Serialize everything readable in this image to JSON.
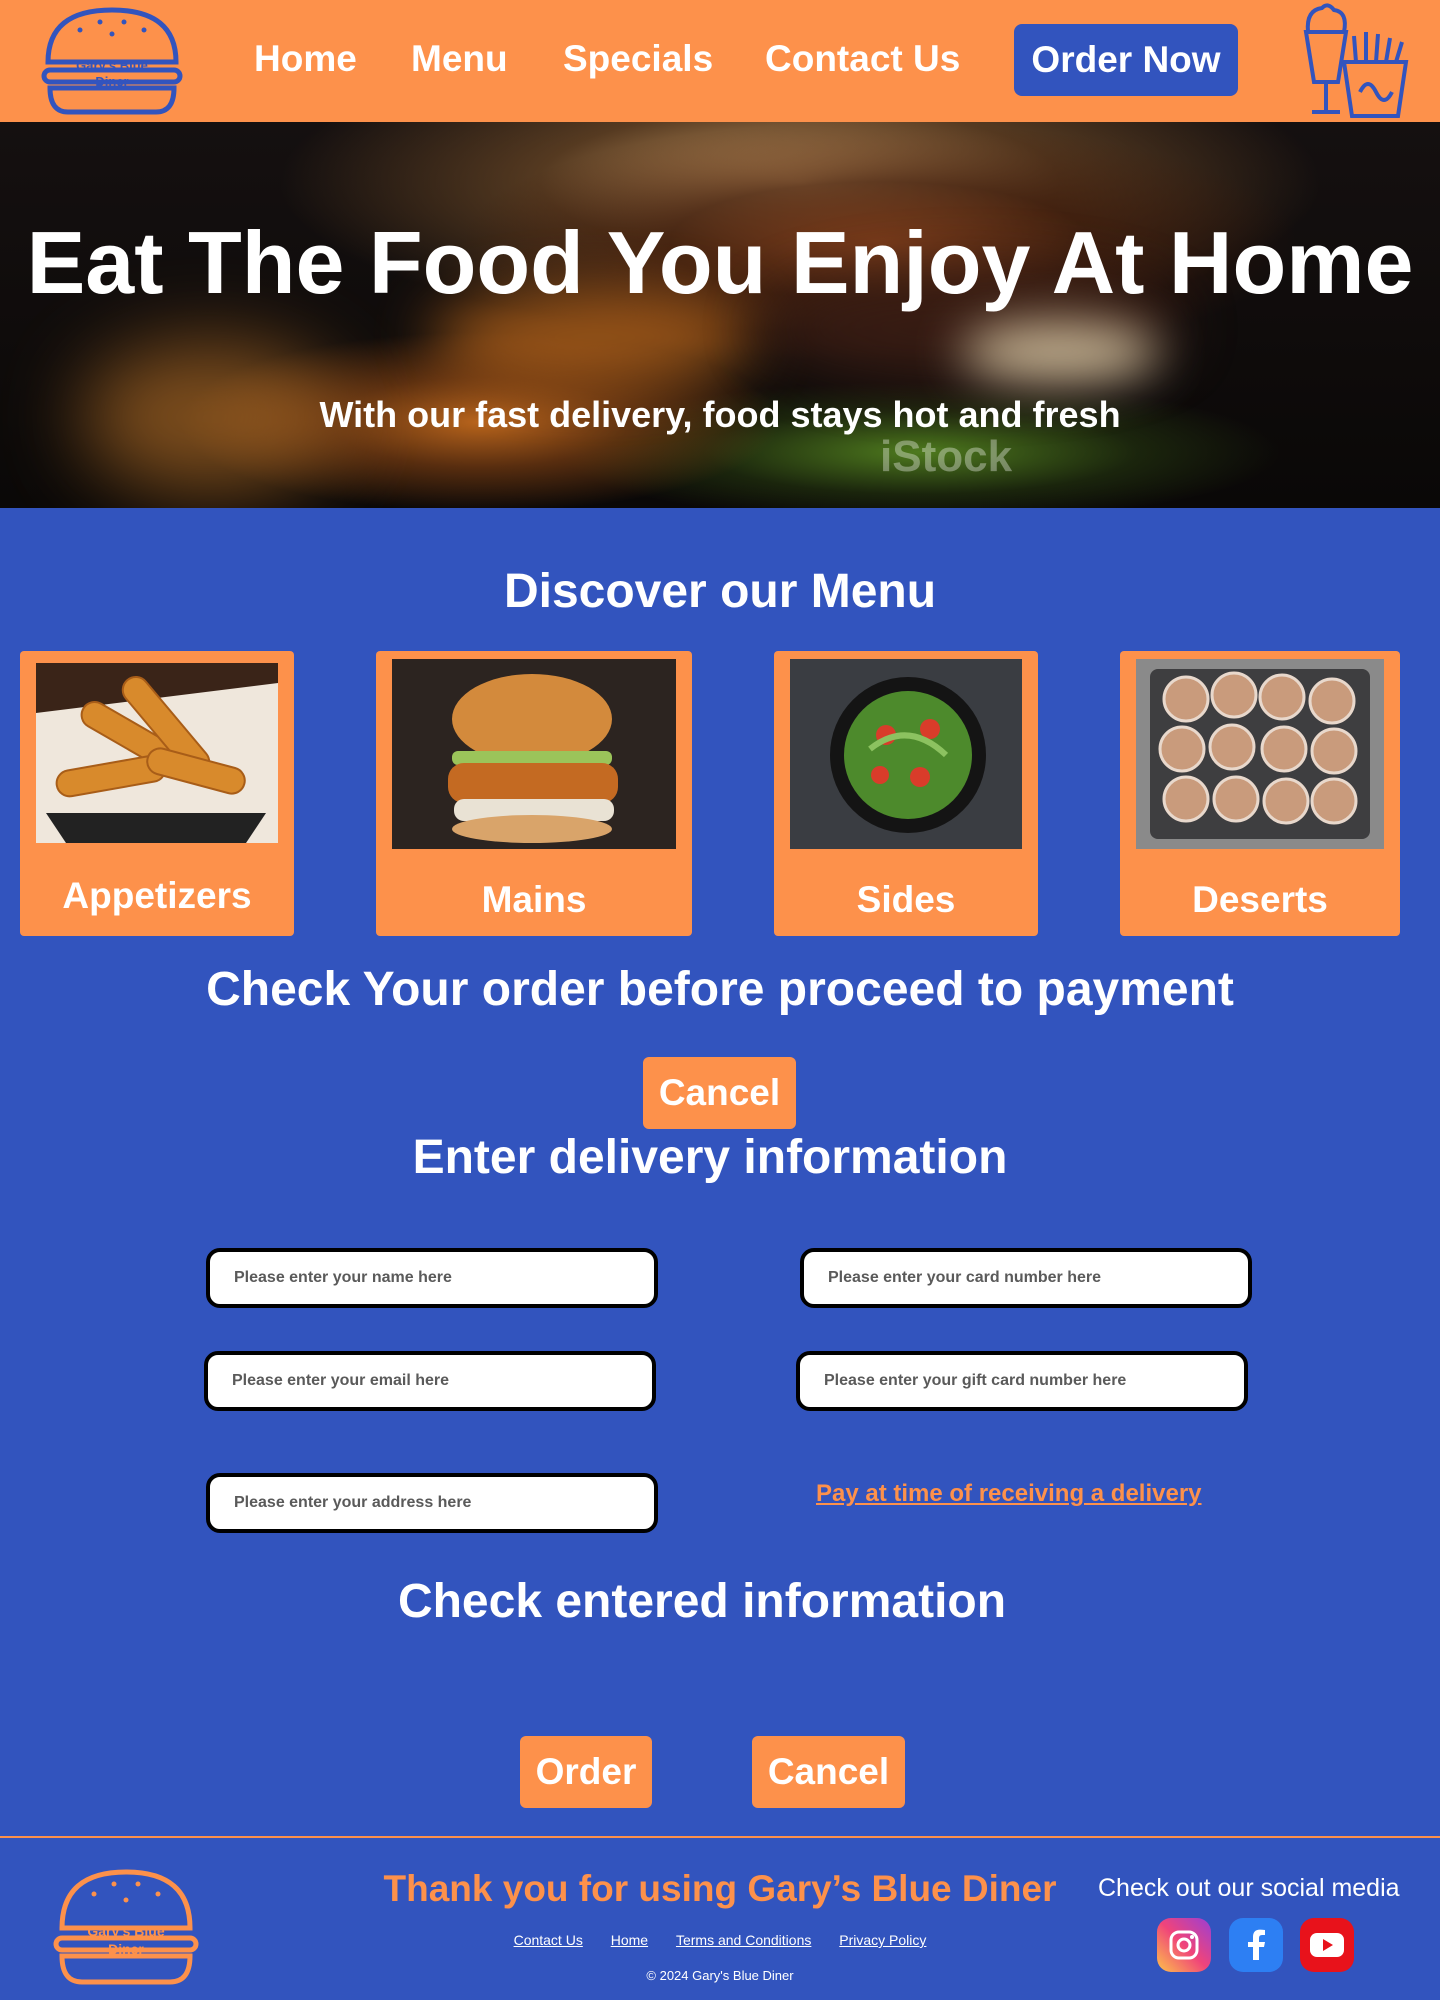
{
  "brand": {
    "name_line1": "Gary's Blue",
    "name_line2": "Diner",
    "primary_color": "#3254be",
    "accent_color": "#fd914b"
  },
  "nav": {
    "items": [
      {
        "label": "Home"
      },
      {
        "label": "Menu"
      },
      {
        "label": "Specials"
      },
      {
        "label": "Contact Us"
      }
    ],
    "cta_label": "Order Now"
  },
  "hero": {
    "title": "Eat The Food You Enjoy At Home",
    "subtitle": "With our fast delivery, food stays hot and fresh",
    "watermark": "iStock"
  },
  "menu": {
    "title": "Discover our Menu",
    "categories": [
      {
        "label": "Appetizers",
        "image_icon": "mozzarella-sticks-photo"
      },
      {
        "label": "Mains",
        "image_icon": "chicken-burger-photo"
      },
      {
        "label": "Sides",
        "image_icon": "salad-bowl-photo"
      },
      {
        "label": "Deserts",
        "image_icon": "sugar-donuts-photo"
      }
    ]
  },
  "order_check": {
    "title": "Check Your order before proceed to payment",
    "cancel_label": "Cancel"
  },
  "delivery": {
    "title": "Enter delivery information",
    "name_placeholder": "Please enter your name here",
    "email_placeholder": "Please enter your email here",
    "address_placeholder": "Please enter your address here",
    "card_placeholder": "Please enter your card number here",
    "giftcard_placeholder": "Please enter your gift card number here",
    "pay_on_delivery_label": "Pay at time of receiving a delivery"
  },
  "confirm": {
    "title": "Check entered information",
    "order_label": "Order",
    "cancel_label": "Cancel"
  },
  "footer": {
    "thanks": "Thank you for using Gary’s Blue Diner",
    "links": [
      {
        "label": "Contact Us"
      },
      {
        "label": "Home"
      },
      {
        "label": "Terms and Conditions"
      },
      {
        "label": "Privacy Policy"
      }
    ],
    "copyright": "© 2024 Gary's Blue Diner",
    "social_title": "Check out our social media",
    "social": [
      {
        "icon": "instagram-icon"
      },
      {
        "icon": "facebook-icon"
      },
      {
        "icon": "youtube-icon"
      }
    ]
  }
}
